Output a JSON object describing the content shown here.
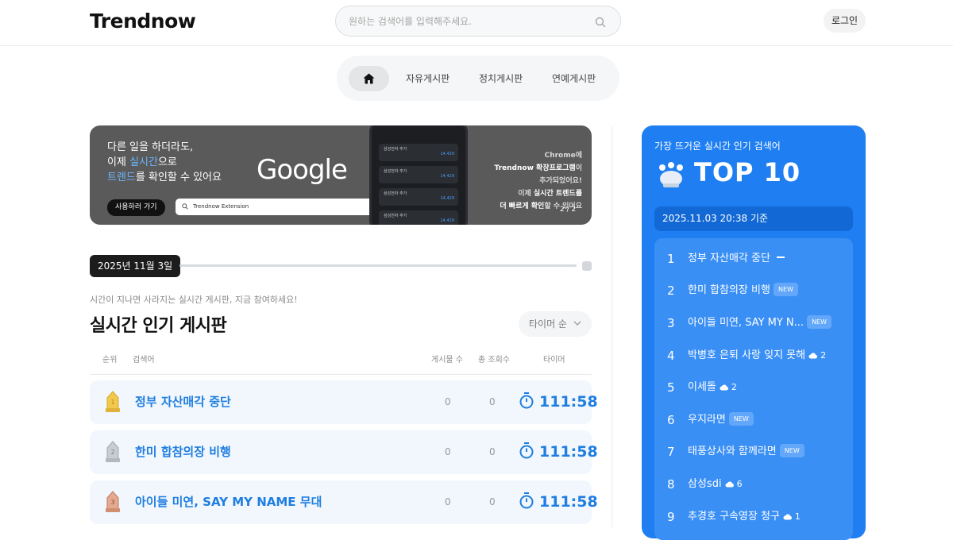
{
  "header": {
    "logo": "Trendnow",
    "search_placeholder": "원하는 검색어를 입력해주세요.",
    "login_label": "로그인"
  },
  "nav": {
    "items": [
      "자유게시판",
      "정치게시판",
      "연예게시판"
    ]
  },
  "banner": {
    "line1": "다른 일을 하더라도,",
    "line2_a": "이제 ",
    "line2_hl": "실시간",
    "line2_b": "으로",
    "line3_hl": "트렌드",
    "line3_b": "를 확인할 수 있어요",
    "cta": "사용하러 가기",
    "google": "Google",
    "search_text": "Trendnow Extension",
    "phone_cards": [
      {
        "title": "삼성전자 추가",
        "value": "14,429"
      },
      {
        "title": "삼성전자 추가",
        "value": "14,429"
      },
      {
        "title": "삼성전자 추가",
        "value": "14,429"
      },
      {
        "title": "삼성전자 추가",
        "value": "14,429"
      }
    ],
    "right_1a": "Chrome",
    "right_1b": "에",
    "right_2a": "Trendnow 확장프로그램",
    "right_2b": "이",
    "right_3": "추가되었어요!",
    "right_4a": "이제 ",
    "right_4b": "실시간 트렌드",
    "right_4c": "를",
    "right_5a": "더 빠르게 확인",
    "right_5b": "할 수 있어요",
    "page": "2 / 2"
  },
  "timeline": {
    "date": "2025년 11월 3일"
  },
  "board": {
    "subtitle": "시간이 지나면 사라지는 실시간 게시판, 지금 참여하세요!",
    "title": "실시간 인기 게시판",
    "sort_label": "타이머 순",
    "columns": {
      "rank": "순위",
      "keyword": "검색어",
      "posts": "게시물 수",
      "views": "총 조회수",
      "timer": "타이머"
    },
    "rows": [
      {
        "keyword": "정부 자산매각 중단",
        "posts": "0",
        "views": "0",
        "time": "111:58",
        "medal": "#f2c94c"
      },
      {
        "keyword": "한미 합참의장 비행",
        "posts": "0",
        "views": "0",
        "time": "111:58",
        "medal": "#b9bdc2"
      },
      {
        "keyword": "아이들 미연, SAY MY NAME 무대",
        "posts": "0",
        "views": "0",
        "time": "111:58",
        "medal": "#d9967a"
      }
    ]
  },
  "sidebar": {
    "heading": "가장 뜨거운 실시간 인기 검색어",
    "top_label": "TOP 10",
    "timestamp": "2025.11.03 20:38 기준",
    "items": [
      {
        "rank": "1",
        "keyword": "정부 자산매각 중단",
        "status": "same",
        "change": ""
      },
      {
        "rank": "2",
        "keyword": "한미 합참의장 비행",
        "status": "new",
        "change": "NEW"
      },
      {
        "rank": "3",
        "keyword": "아이들 미연, SAY MY N...",
        "status": "new",
        "change": "NEW"
      },
      {
        "rank": "4",
        "keyword": "박병호 은퇴 사랑 잊지 못해",
        "status": "up",
        "change": "2"
      },
      {
        "rank": "5",
        "keyword": "이세돌",
        "status": "up",
        "change": "2"
      },
      {
        "rank": "6",
        "keyword": "우지라면",
        "status": "new",
        "change": "NEW"
      },
      {
        "rank": "7",
        "keyword": "태풍상사와 함께라면",
        "status": "new",
        "change": "NEW"
      },
      {
        "rank": "8",
        "keyword": "삼성sdi",
        "status": "up",
        "change": "6"
      },
      {
        "rank": "9",
        "keyword": "추경호 구속영장 청구",
        "status": "up",
        "change": "1"
      }
    ]
  },
  "colors": {
    "accent": "#1f7ff2",
    "keyword_blue": "#1f7ee0",
    "row_bg": "#f1f7fd"
  }
}
